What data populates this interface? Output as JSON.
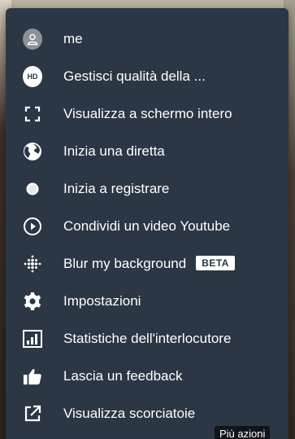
{
  "menu": {
    "items": [
      {
        "label": "me",
        "icon": "avatar-icon"
      },
      {
        "label": "Gestisci qualità della ...",
        "icon": "hd-icon",
        "icon_text": "HD"
      },
      {
        "label": "Visualizza a schermo intero",
        "icon": "fullscreen-icon"
      },
      {
        "label": "Inizia una diretta",
        "icon": "globe-icon"
      },
      {
        "label": "Inizia a registrare",
        "icon": "record-icon"
      },
      {
        "label": "Condividi un video Youtube",
        "icon": "play-circle-icon"
      },
      {
        "label": "Blur my background",
        "icon": "blur-dots-icon",
        "badge": "BETA"
      },
      {
        "label": "Impostazioni",
        "icon": "gear-icon"
      },
      {
        "label": "Statistiche dell'interlocutore",
        "icon": "bar-chart-icon"
      },
      {
        "label": "Lascia un feedback",
        "icon": "thumbs-up-icon"
      },
      {
        "label": "Visualizza scorciatoie",
        "icon": "external-link-icon"
      }
    ]
  },
  "tooltip": {
    "text": "Più azioni"
  },
  "colors": {
    "menu_bg": "#2b3745",
    "text": "#ffffff",
    "tooltip_bg": "#111418"
  }
}
